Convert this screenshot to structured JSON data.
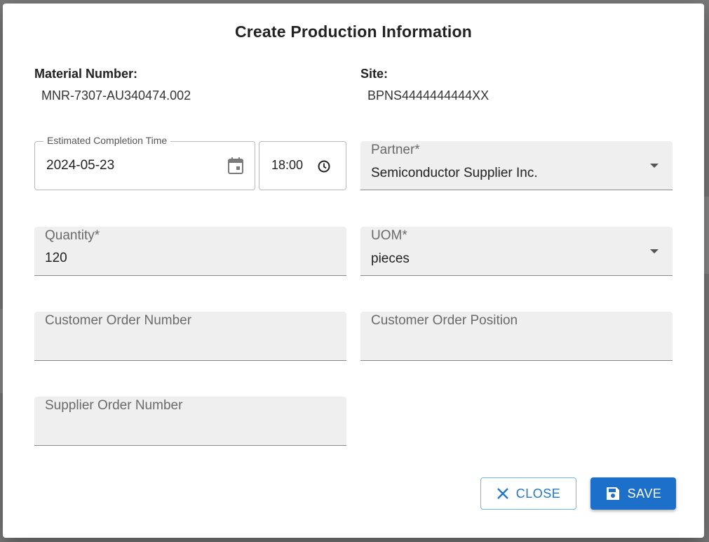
{
  "dialog": {
    "title": "Create Production Information",
    "material_number": {
      "label": "Material Number:",
      "value": "MNR-7307-AU340474.002"
    },
    "site": {
      "label": "Site:",
      "value": "BPNS4444444444XX"
    },
    "estimated_completion": {
      "label": "Estimated Completion Time",
      "date": "2024-05-23",
      "time": "18:00"
    },
    "partner": {
      "label": "Partner*",
      "value": "Semiconductor Supplier Inc."
    },
    "quantity": {
      "label": "Quantity*",
      "value": "120"
    },
    "uom": {
      "label": "UOM*",
      "value": "pieces"
    },
    "customer_order_number": {
      "label": "Customer Order Number",
      "value": ""
    },
    "customer_order_position": {
      "label": "Customer Order Position",
      "value": ""
    },
    "supplier_order_number": {
      "label": "Supplier Order Number",
      "value": ""
    },
    "buttons": {
      "close": "CLOSE",
      "save": "SAVE"
    }
  },
  "colors": {
    "accent": "#1d70c9",
    "outline_accent": "#6fb7e6",
    "filled_bg": "#efefef"
  },
  "icons": {
    "date": "calendar-icon",
    "time": "clock-icon",
    "close": "close-icon",
    "save": "floppy-disk-icon",
    "dropdown": "chevron-down-icon"
  }
}
